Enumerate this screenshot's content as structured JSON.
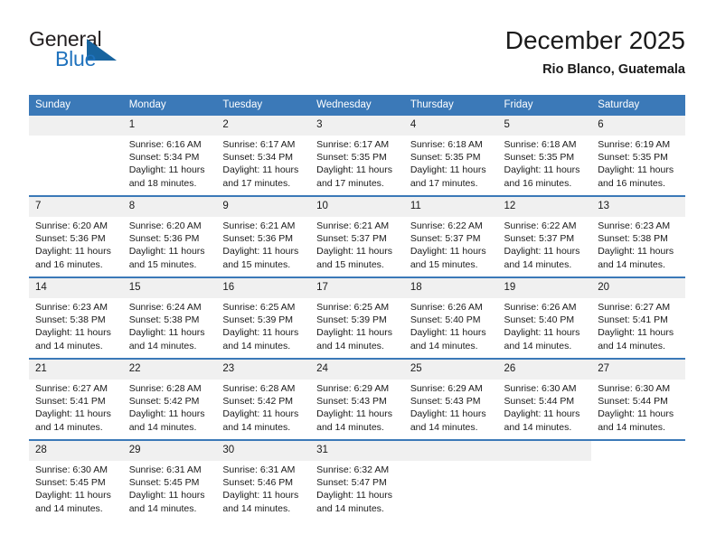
{
  "brand": {
    "name_part1": "General",
    "name_part2": "Blue",
    "triangle_icon": "triangle-icon",
    "blue_hex": "#1f72bd",
    "dark_hex": "#231f20"
  },
  "header": {
    "title": "December 2025",
    "subtitle": "Rio Blanco, Guatemala",
    "header_bg_hex": "#3b79b8",
    "daynum_bg_hex": "#f0f0f0"
  },
  "weekdays": [
    "Sunday",
    "Monday",
    "Tuesday",
    "Wednesday",
    "Thursday",
    "Friday",
    "Saturday"
  ],
  "weeks": [
    [
      {
        "day": "",
        "sunrise": "",
        "sunset": "",
        "daylight1": "",
        "daylight2": "",
        "empty": true
      },
      {
        "day": "1",
        "sunrise": "Sunrise: 6:16 AM",
        "sunset": "Sunset: 5:34 PM",
        "daylight1": "Daylight: 11 hours",
        "daylight2": "and 18 minutes."
      },
      {
        "day": "2",
        "sunrise": "Sunrise: 6:17 AM",
        "sunset": "Sunset: 5:34 PM",
        "daylight1": "Daylight: 11 hours",
        "daylight2": "and 17 minutes."
      },
      {
        "day": "3",
        "sunrise": "Sunrise: 6:17 AM",
        "sunset": "Sunset: 5:35 PM",
        "daylight1": "Daylight: 11 hours",
        "daylight2": "and 17 minutes."
      },
      {
        "day": "4",
        "sunrise": "Sunrise: 6:18 AM",
        "sunset": "Sunset: 5:35 PM",
        "daylight1": "Daylight: 11 hours",
        "daylight2": "and 17 minutes."
      },
      {
        "day": "5",
        "sunrise": "Sunrise: 6:18 AM",
        "sunset": "Sunset: 5:35 PM",
        "daylight1": "Daylight: 11 hours",
        "daylight2": "and 16 minutes."
      },
      {
        "day": "6",
        "sunrise": "Sunrise: 6:19 AM",
        "sunset": "Sunset: 5:35 PM",
        "daylight1": "Daylight: 11 hours",
        "daylight2": "and 16 minutes."
      }
    ],
    [
      {
        "day": "7",
        "sunrise": "Sunrise: 6:20 AM",
        "sunset": "Sunset: 5:36 PM",
        "daylight1": "Daylight: 11 hours",
        "daylight2": "and 16 minutes."
      },
      {
        "day": "8",
        "sunrise": "Sunrise: 6:20 AM",
        "sunset": "Sunset: 5:36 PM",
        "daylight1": "Daylight: 11 hours",
        "daylight2": "and 15 minutes."
      },
      {
        "day": "9",
        "sunrise": "Sunrise: 6:21 AM",
        "sunset": "Sunset: 5:36 PM",
        "daylight1": "Daylight: 11 hours",
        "daylight2": "and 15 minutes."
      },
      {
        "day": "10",
        "sunrise": "Sunrise: 6:21 AM",
        "sunset": "Sunset: 5:37 PM",
        "daylight1": "Daylight: 11 hours",
        "daylight2": "and 15 minutes."
      },
      {
        "day": "11",
        "sunrise": "Sunrise: 6:22 AM",
        "sunset": "Sunset: 5:37 PM",
        "daylight1": "Daylight: 11 hours",
        "daylight2": "and 15 minutes."
      },
      {
        "day": "12",
        "sunrise": "Sunrise: 6:22 AM",
        "sunset": "Sunset: 5:37 PM",
        "daylight1": "Daylight: 11 hours",
        "daylight2": "and 14 minutes."
      },
      {
        "day": "13",
        "sunrise": "Sunrise: 6:23 AM",
        "sunset": "Sunset: 5:38 PM",
        "daylight1": "Daylight: 11 hours",
        "daylight2": "and 14 minutes."
      }
    ],
    [
      {
        "day": "14",
        "sunrise": "Sunrise: 6:23 AM",
        "sunset": "Sunset: 5:38 PM",
        "daylight1": "Daylight: 11 hours",
        "daylight2": "and 14 minutes."
      },
      {
        "day": "15",
        "sunrise": "Sunrise: 6:24 AM",
        "sunset": "Sunset: 5:38 PM",
        "daylight1": "Daylight: 11 hours",
        "daylight2": "and 14 minutes."
      },
      {
        "day": "16",
        "sunrise": "Sunrise: 6:25 AM",
        "sunset": "Sunset: 5:39 PM",
        "daylight1": "Daylight: 11 hours",
        "daylight2": "and 14 minutes."
      },
      {
        "day": "17",
        "sunrise": "Sunrise: 6:25 AM",
        "sunset": "Sunset: 5:39 PM",
        "daylight1": "Daylight: 11 hours",
        "daylight2": "and 14 minutes."
      },
      {
        "day": "18",
        "sunrise": "Sunrise: 6:26 AM",
        "sunset": "Sunset: 5:40 PM",
        "daylight1": "Daylight: 11 hours",
        "daylight2": "and 14 minutes."
      },
      {
        "day": "19",
        "sunrise": "Sunrise: 6:26 AM",
        "sunset": "Sunset: 5:40 PM",
        "daylight1": "Daylight: 11 hours",
        "daylight2": "and 14 minutes."
      },
      {
        "day": "20",
        "sunrise": "Sunrise: 6:27 AM",
        "sunset": "Sunset: 5:41 PM",
        "daylight1": "Daylight: 11 hours",
        "daylight2": "and 14 minutes."
      }
    ],
    [
      {
        "day": "21",
        "sunrise": "Sunrise: 6:27 AM",
        "sunset": "Sunset: 5:41 PM",
        "daylight1": "Daylight: 11 hours",
        "daylight2": "and 14 minutes."
      },
      {
        "day": "22",
        "sunrise": "Sunrise: 6:28 AM",
        "sunset": "Sunset: 5:42 PM",
        "daylight1": "Daylight: 11 hours",
        "daylight2": "and 14 minutes."
      },
      {
        "day": "23",
        "sunrise": "Sunrise: 6:28 AM",
        "sunset": "Sunset: 5:42 PM",
        "daylight1": "Daylight: 11 hours",
        "daylight2": "and 14 minutes."
      },
      {
        "day": "24",
        "sunrise": "Sunrise: 6:29 AM",
        "sunset": "Sunset: 5:43 PM",
        "daylight1": "Daylight: 11 hours",
        "daylight2": "and 14 minutes."
      },
      {
        "day": "25",
        "sunrise": "Sunrise: 6:29 AM",
        "sunset": "Sunset: 5:43 PM",
        "daylight1": "Daylight: 11 hours",
        "daylight2": "and 14 minutes."
      },
      {
        "day": "26",
        "sunrise": "Sunrise: 6:30 AM",
        "sunset": "Sunset: 5:44 PM",
        "daylight1": "Daylight: 11 hours",
        "daylight2": "and 14 minutes."
      },
      {
        "day": "27",
        "sunrise": "Sunrise: 6:30 AM",
        "sunset": "Sunset: 5:44 PM",
        "daylight1": "Daylight: 11 hours",
        "daylight2": "and 14 minutes."
      }
    ],
    [
      {
        "day": "28",
        "sunrise": "Sunrise: 6:30 AM",
        "sunset": "Sunset: 5:45 PM",
        "daylight1": "Daylight: 11 hours",
        "daylight2": "and 14 minutes."
      },
      {
        "day": "29",
        "sunrise": "Sunrise: 6:31 AM",
        "sunset": "Sunset: 5:45 PM",
        "daylight1": "Daylight: 11 hours",
        "daylight2": "and 14 minutes."
      },
      {
        "day": "30",
        "sunrise": "Sunrise: 6:31 AM",
        "sunset": "Sunset: 5:46 PM",
        "daylight1": "Daylight: 11 hours",
        "daylight2": "and 14 minutes."
      },
      {
        "day": "31",
        "sunrise": "Sunrise: 6:32 AM",
        "sunset": "Sunset: 5:47 PM",
        "daylight1": "Daylight: 11 hours",
        "daylight2": "and 14 minutes."
      },
      {
        "day": "",
        "sunrise": "",
        "sunset": "",
        "daylight1": "",
        "daylight2": "",
        "empty": true
      },
      {
        "day": "",
        "sunrise": "",
        "sunset": "",
        "daylight1": "",
        "daylight2": "",
        "empty": true
      },
      {
        "day": "",
        "sunrise": "",
        "sunset": "",
        "daylight1": "",
        "daylight2": "",
        "empty": true,
        "nofill": true
      }
    ]
  ]
}
